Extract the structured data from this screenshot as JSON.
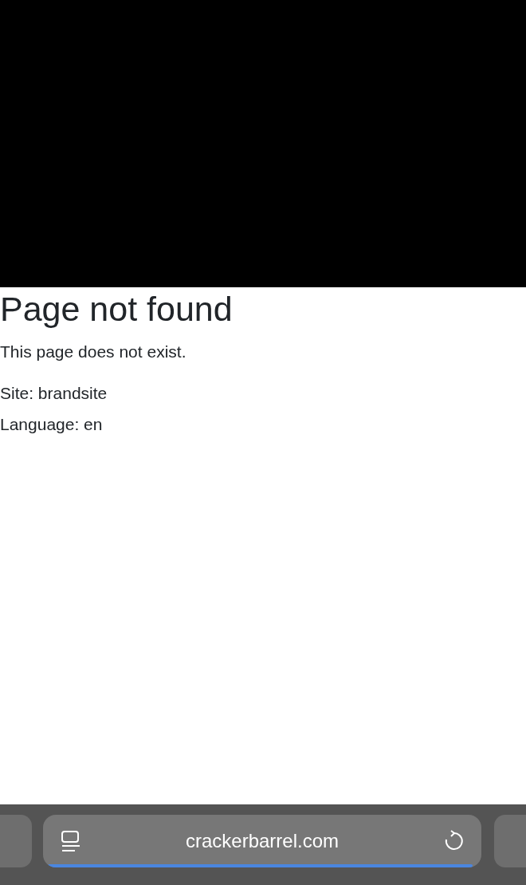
{
  "page": {
    "heading": "Page not found",
    "message": "This page does not exist.",
    "details": [
      "Site: brandsite",
      "Language: en"
    ]
  },
  "address_bar": {
    "url": "crackerbarrel.com",
    "load_progress": {
      "level": 0.99
    }
  }
}
